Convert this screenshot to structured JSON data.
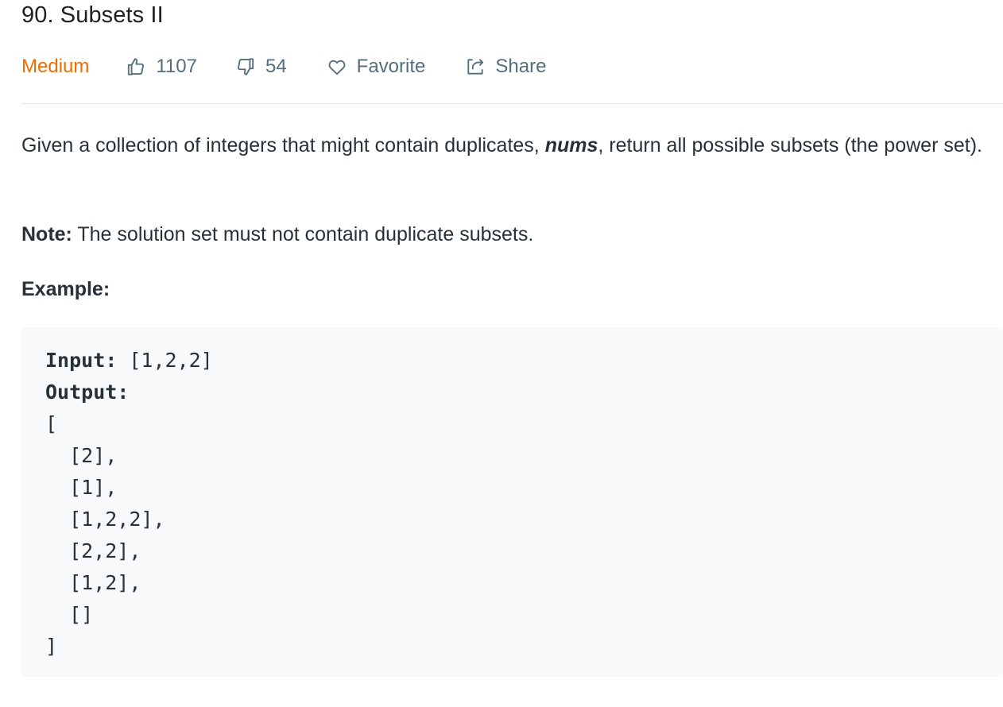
{
  "problem": {
    "title": "90. Subsets II",
    "difficulty": "Medium",
    "likes": "1107",
    "dislikes": "54",
    "favorite_label": "Favorite",
    "share_label": "Share"
  },
  "description": {
    "part1": "Given a collection of integers that might contain duplicates, ",
    "var": "nums",
    "part2": ", return all possible subsets (the power set)."
  },
  "note": {
    "label": "Note:",
    "text": " The solution set must not contain duplicate subsets."
  },
  "example": {
    "heading": "Example:",
    "input_label": "Input:",
    "input_value": " [1,2,2]",
    "output_label": "Output:",
    "output_lines": [
      "[",
      "  [2],",
      "  [1],",
      "  [1,2,2],",
      "  [2,2],",
      "  [1,2],",
      "  []",
      "]"
    ]
  },
  "colors": {
    "difficulty": "#ef6c00",
    "meta": "#546e7a",
    "code_bg": "#f7f9fa"
  },
  "icons": [
    "thumbs-up-icon",
    "thumbs-down-icon",
    "heart-icon",
    "share-icon"
  ]
}
